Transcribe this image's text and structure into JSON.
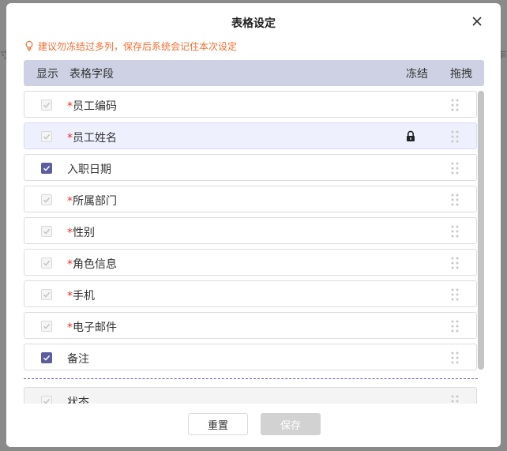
{
  "background": {
    "left_edge_text": "寸",
    "right_edge_text": "乍"
  },
  "dialog": {
    "title": "表格设定",
    "notice": "建议勿冻结过多列，保存后系统会记住本次设定"
  },
  "table_header": {
    "show": "显示",
    "field": "表格字段",
    "freeze": "冻结",
    "drag": "拖拽"
  },
  "rows": [
    {
      "label": "员工编码",
      "required": "*",
      "checked": true,
      "disabled": true,
      "frozen": false
    },
    {
      "label": "员工姓名",
      "required": "*",
      "checked": true,
      "disabled": true,
      "frozen": true
    },
    {
      "label": "入职日期",
      "required": "",
      "checked": true,
      "disabled": false,
      "frozen": false
    },
    {
      "label": "所属部门",
      "required": "*",
      "checked": true,
      "disabled": true,
      "frozen": false
    },
    {
      "label": "性别",
      "required": "*",
      "checked": true,
      "disabled": true,
      "frozen": false
    },
    {
      "label": "角色信息",
      "required": "*",
      "checked": true,
      "disabled": true,
      "frozen": false
    },
    {
      "label": "手机",
      "required": "*",
      "checked": true,
      "disabled": true,
      "frozen": false
    },
    {
      "label": "电子邮件",
      "required": "*",
      "checked": true,
      "disabled": true,
      "frozen": false
    },
    {
      "label": "备注",
      "required": "",
      "checked": true,
      "disabled": false,
      "frozen": false
    },
    {
      "label": "状态",
      "required": "",
      "checked": true,
      "disabled": true,
      "frozen": false
    }
  ],
  "footer": {
    "reset_label": "重置",
    "save_label": "保存"
  },
  "colors": {
    "accent": "#5b5d9e",
    "header_bg": "#ced1e3",
    "notice": "#f07034",
    "required": "#e5312c"
  }
}
